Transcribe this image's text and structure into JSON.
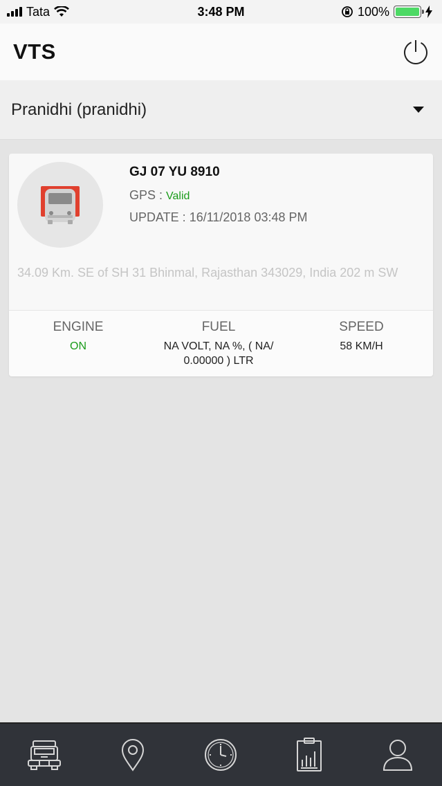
{
  "status_bar": {
    "carrier": "Tata",
    "time": "3:48 PM",
    "battery": "100%",
    "battery_level": 1.0
  },
  "header": {
    "title": "VTS",
    "power_icon": "power-icon"
  },
  "account_selector": {
    "selected": "Pranidhi (pranidhi)",
    "caret_icon": "caret-down-icon"
  },
  "vehicle": {
    "plate": "GJ 07 YU 8910",
    "gps_label": "GPS : ",
    "gps_status": "Valid",
    "update_label": "UPDATE : ",
    "update_time": "16/11/2018 03:48 PM",
    "address": "34.09 Km. SE of SH 31 Bhinmal, Rajasthan 343029, India 202 m SW",
    "icon": "bus-icon",
    "stats": {
      "engine_label": "ENGINE",
      "engine_value": "ON",
      "fuel_label": "FUEL",
      "fuel_value": "NA VOLT, NA %, ( NA/ 0.00000 ) LTR",
      "speed_label": "SPEED",
      "speed_value": "58 KM/H"
    }
  },
  "tabbar": {
    "tabs": [
      "truck-icon",
      "location-pin-icon",
      "clock-icon",
      "report-icon",
      "user-icon"
    ]
  },
  "colors": {
    "status_green": "#1a9c1a",
    "bus_red": "#e0402e",
    "tabbar_bg": "#303339"
  }
}
